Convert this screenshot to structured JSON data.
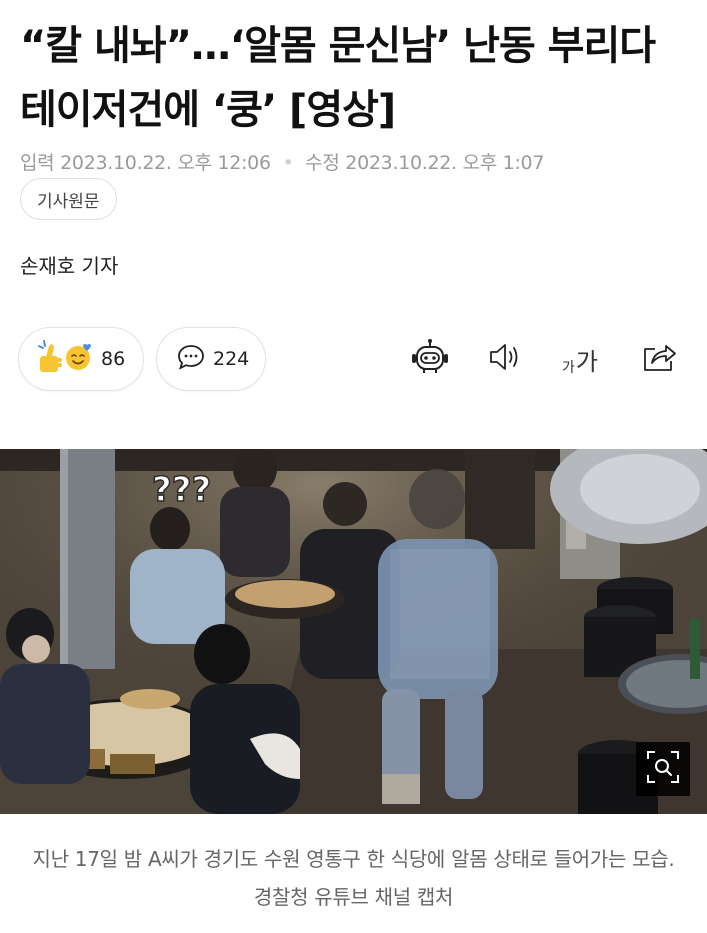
{
  "article": {
    "headline": "“칼 내놔”…‘알몸 문신남’ 난동 부리다 테이저건에 ‘쿵’ [영상]",
    "published_label": "입력",
    "published": "2023.10.22. 오후 12:06",
    "modified_label": "수정",
    "modified": "2023.10.22. 오후 1:07",
    "source_button": "기사원문",
    "reporter": "손재호 기자"
  },
  "toolbar": {
    "reaction_count": "86",
    "comment_count": "224",
    "font_small": "가",
    "font_big": "가",
    "icons": [
      "thumbs-up-icon",
      "smile-face-icon",
      "comment-icon",
      "robot-summary-icon",
      "audio-speaker-icon",
      "font-size-icon",
      "share-icon"
    ]
  },
  "photo": {
    "overlay_text": "???",
    "zoom_icon": "zoom-icon",
    "caption": "지난 17일 밤 A씨가 경기도 수원 영통구 한 식당에 알몸 상태로 들어가는 모습. 경찰청 유튜브 채널 캡처"
  },
  "colors": {
    "accent_yellow": "#f7c531",
    "text_primary": "#111111",
    "text_meta": "#9a9a9a",
    "border": "#e2e2e2"
  }
}
